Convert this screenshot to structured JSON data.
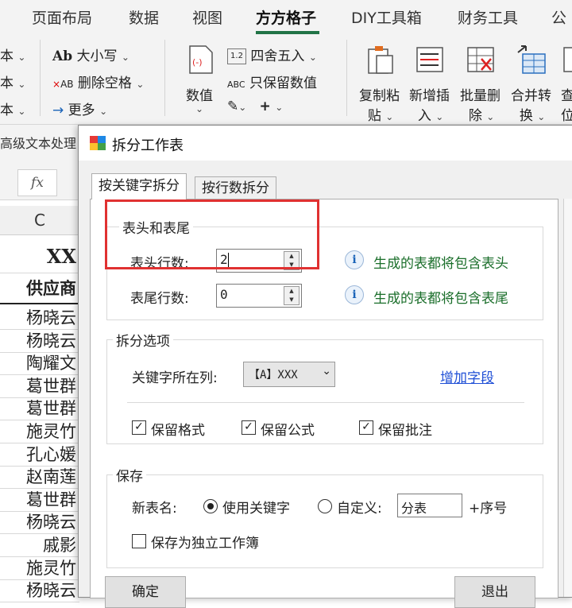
{
  "ribbon_tabs": [
    "页面布局",
    "数据",
    "视图",
    "方方格子",
    "DIY工具箱",
    "财务工具",
    "公"
  ],
  "ribbon": {
    "left_items": [
      "本",
      "本",
      "本"
    ],
    "case": "大小写",
    "delete_space": "删除空格",
    "more": "更多",
    "value": "数值",
    "round": "四舍五入",
    "keep_values": "只保留数值",
    "copy_paste": [
      "复制粘",
      "贴"
    ],
    "insert": [
      "新增插",
      "入"
    ],
    "batch_delete": [
      "批量删",
      "除"
    ],
    "merge": [
      "合并转",
      "换"
    ],
    "look": [
      "查",
      "位"
    ],
    "group_label": "高级文本处理"
  },
  "sheet": {
    "fx": "fx",
    "column": "C",
    "title_cell": "XX",
    "header_cell": "供应商",
    "rows": [
      "杨晓云",
      "杨晓云",
      "陶耀文",
      "葛世群",
      "葛世群",
      "施灵竹",
      "孔心媛",
      "赵南莲",
      "葛世群",
      "杨晓云",
      "戚影",
      "施灵竹",
      "杨晓云"
    ]
  },
  "dialog": {
    "title": "拆分工作表",
    "tabs": [
      "按关键字拆分",
      "按行数拆分"
    ],
    "header_footer": {
      "legend": "表头和表尾",
      "header_label": "表头行数:",
      "header_value": "2",
      "footer_label": "表尾行数:",
      "footer_value": "0",
      "header_hint": "生成的表都将包含表头",
      "footer_hint": "生成的表都将包含表尾"
    },
    "split_options": {
      "legend": "拆分选项",
      "keyword_col_label": "关键字所在列:",
      "keyword_col_value": "【A】XXX",
      "add_field": "增加字段",
      "keep_format": "保留格式",
      "keep_formula": "保留公式",
      "keep_comment": "保留批注"
    },
    "save": {
      "legend": "保存",
      "new_name_label": "新表名:",
      "use_keyword": "使用关键字",
      "custom": "自定义:",
      "custom_value": "分表",
      "suffix": "+序号",
      "save_independent": "保存为独立工作簿"
    },
    "ok": "确定",
    "exit": "退出"
  },
  "colors": {
    "accent": "#217346",
    "highlight": "#e03131",
    "hint": "#1a6e2a",
    "link": "#1f4fd6"
  }
}
